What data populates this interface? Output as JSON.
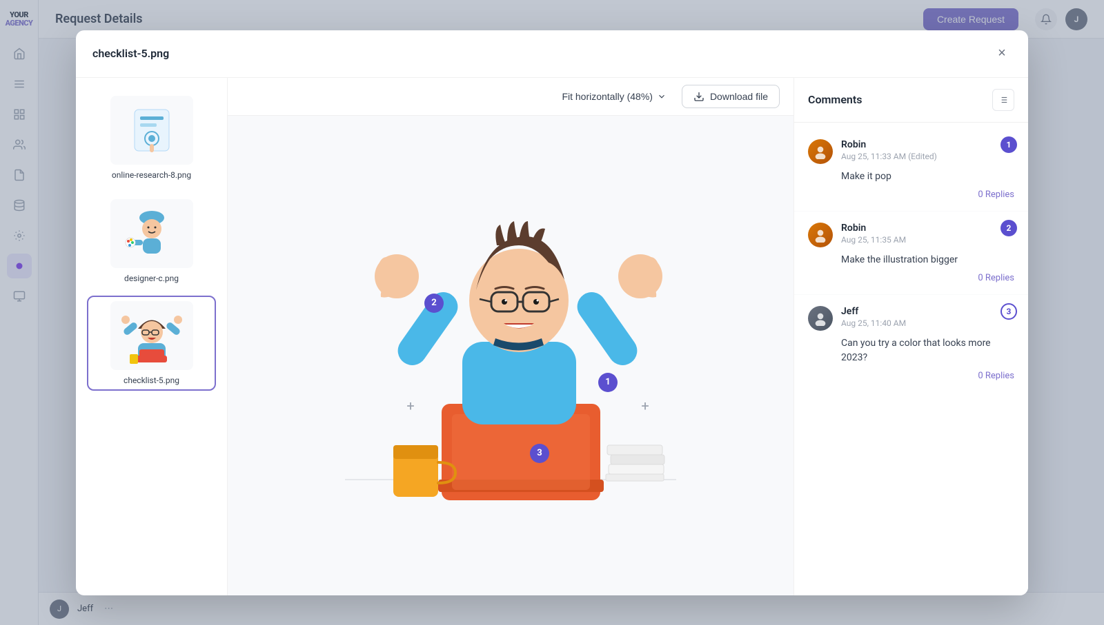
{
  "app": {
    "title": "YOURAGENCY",
    "page_title": "Request Details",
    "create_request_label": "Create Request"
  },
  "modal": {
    "title": "checklist-5.png",
    "close_label": "×",
    "fit_label": "Fit horizontally (48%)",
    "download_label": "Download file",
    "files": [
      {
        "name": "online-research-8.png",
        "selected": false,
        "thumb_type": "online-research"
      },
      {
        "name": "designer-c.png",
        "selected": false,
        "thumb_type": "designer"
      },
      {
        "name": "checklist-5.png",
        "selected": true,
        "thumb_type": "checklist"
      }
    ],
    "annotation_dots": [
      {
        "number": 1,
        "label": "1"
      },
      {
        "number": 2,
        "label": "2"
      },
      {
        "number": 3,
        "label": "3"
      }
    ]
  },
  "comments": {
    "title": "Comments",
    "items": [
      {
        "id": 1,
        "author": "Robin",
        "time": "Aug 25, 11:33 AM",
        "edited": true,
        "body": "Make it pop",
        "replies_count": 0,
        "replies_label": "0 Replies",
        "badge_number": "1",
        "avatar_type": "robin"
      },
      {
        "id": 2,
        "author": "Robin",
        "time": "Aug 25, 11:35 AM",
        "edited": false,
        "body": "Make the illustration bigger",
        "replies_count": 0,
        "replies_label": "0 Replies",
        "badge_number": "2",
        "avatar_type": "robin"
      },
      {
        "id": 3,
        "author": "Jeff",
        "time": "Aug 25, 11:40 AM",
        "edited": false,
        "body": "Can you try a color that looks more 2023?",
        "replies_count": 0,
        "replies_label": "0 Replies",
        "badge_number": "3",
        "avatar_type": "jeff",
        "badge_outline": true
      }
    ]
  },
  "sidebar": {
    "items": [
      {
        "icon": "home",
        "label": "Home",
        "active": false
      },
      {
        "icon": "menu",
        "label": "Menu",
        "active": false
      },
      {
        "icon": "grid",
        "label": "Grid",
        "active": false
      },
      {
        "icon": "users",
        "label": "Users",
        "active": false
      },
      {
        "icon": "file",
        "label": "Files",
        "active": false
      },
      {
        "icon": "database",
        "label": "Database",
        "active": false
      },
      {
        "icon": "settings",
        "label": "Settings",
        "active": false
      },
      {
        "icon": "circle",
        "label": "Active",
        "active": true
      }
    ]
  },
  "current_user": {
    "name": "Jeff",
    "avatar_type": "jeff"
  }
}
